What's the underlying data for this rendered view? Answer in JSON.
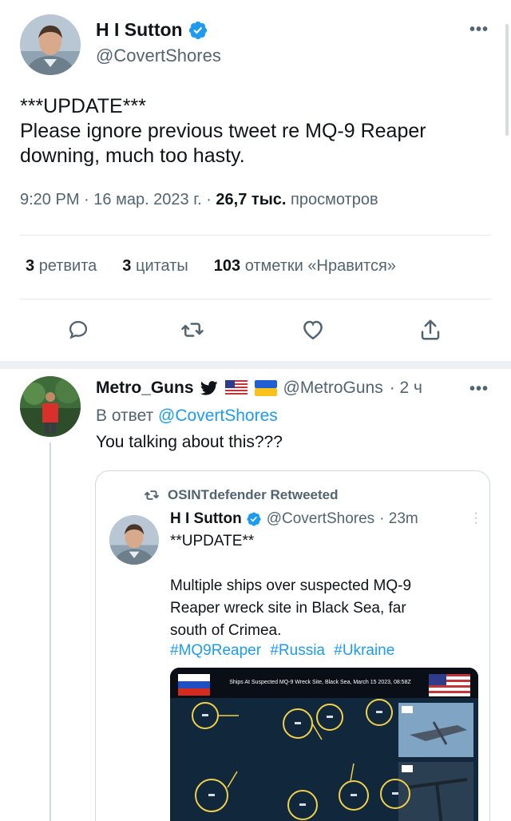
{
  "main_tweet": {
    "author_name": "H I Sutton",
    "author_handle": "@CovertShores",
    "text_lines": [
      "***UPDATE***",
      "Please ignore previous tweet re MQ-9 Reaper",
      "downing, much too hasty."
    ],
    "time": "9:20 PM",
    "date": "16 мар. 2023 г.",
    "views_count": "26,7 тыс.",
    "views_label": "просмотров",
    "stats": {
      "retweets_count": "3",
      "retweets_label": "ретвита",
      "quotes_count": "3",
      "quotes_label": "цитаты",
      "likes_count": "103",
      "likes_label": "отметки «Нравится»"
    },
    "actions": [
      "reply",
      "retweet",
      "like",
      "share"
    ]
  },
  "reply": {
    "author_name": "Metro_Guns",
    "flags": [
      "us-flag",
      "ukraine-flag"
    ],
    "author_handle": "@MetroGuns",
    "time": "· 2 ч",
    "reply_prefix": "В ответ",
    "reply_to": "@CovertShores",
    "text": "You talking about this???"
  },
  "embedded": {
    "retweeted_by": "OSINTdefender Retweeted",
    "author_name": "H I Sutton",
    "author_handle": "@CovertShores",
    "time": "· 23m",
    "update_text": "**UPDATE**",
    "text_lines": [
      "Multiple ships over suspected MQ-9",
      "Reaper wreck site in Black Sea, far",
      "south of Crimea."
    ],
    "hashtags": [
      "#MQ9Reaper",
      "#Russia",
      "#Ukraine"
    ],
    "image_caption": "Ships At Suspected MQ-9 Wreck Site, Black Sea, March 15 2023, 08:58Z"
  },
  "colors": {
    "link": "#1d9bf0",
    "verified": "#1d9bf0",
    "muted": "#536471",
    "text": "#0f1419"
  }
}
